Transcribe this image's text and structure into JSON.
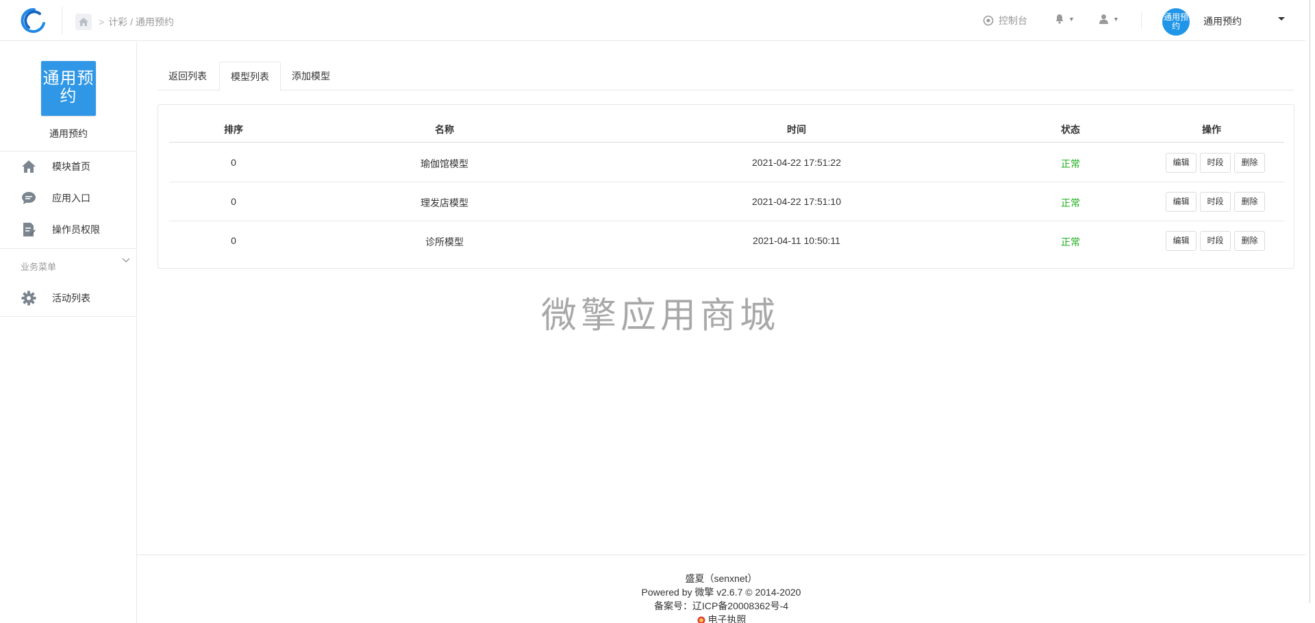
{
  "topbar": {
    "breadcrumb": "计彩 / 通用预约",
    "console_label": "控制台",
    "avatar_text": "通用预约",
    "user_name": "通用预约"
  },
  "sidebar": {
    "module_logo_text": "通用预约",
    "module_name": "通用预约",
    "items": [
      {
        "label": "模块首页",
        "icon": "home-icon"
      },
      {
        "label": "应用入口",
        "icon": "chat-icon"
      },
      {
        "label": "操作员权限",
        "icon": "permission-icon"
      }
    ],
    "group_label": "业务菜单",
    "group_items": [
      {
        "label": "活动列表",
        "icon": "gear-icon"
      }
    ]
  },
  "tabs": [
    {
      "label": "返回列表",
      "active": false
    },
    {
      "label": "模型列表",
      "active": true
    },
    {
      "label": "添加模型",
      "active": false
    }
  ],
  "table": {
    "headers": [
      "排序",
      "名称",
      "时间",
      "状态",
      "操作"
    ],
    "rows": [
      {
        "order": "0",
        "name": "瑜伽馆模型",
        "time": "2021-04-22 17:51:22",
        "status": "正常"
      },
      {
        "order": "0",
        "name": "理发店模型",
        "time": "2021-04-22 17:51:10",
        "status": "正常"
      },
      {
        "order": "0",
        "name": "诊所模型",
        "time": "2021-04-11 10:50:11",
        "status": "正常"
      }
    ],
    "actions": [
      "编辑",
      "时段",
      "删除"
    ],
    "status_color": "#1aad19"
  },
  "watermark": "微擎应用商城",
  "footer": {
    "line1": "盛夏（senxnet）",
    "line2": "Powered by 微擎 v2.6.7 © 2014-2020",
    "line3": "备案号：辽ICP备20008362号-4",
    "line4": "电子执照"
  },
  "colors": {
    "accent": "#2196e8",
    "border": "#e7e7eb"
  }
}
